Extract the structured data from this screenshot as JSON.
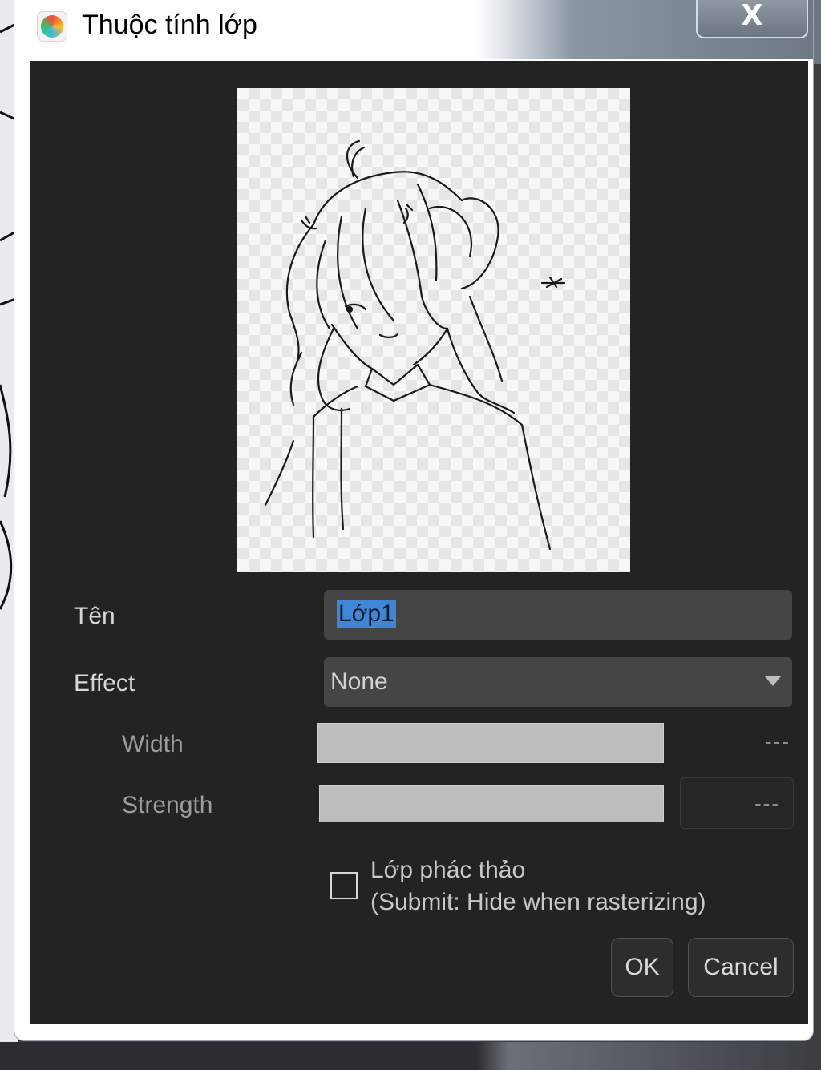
{
  "window": {
    "title": "Thuộc tính lớp",
    "close_label": "X"
  },
  "form": {
    "name_label": "Tên",
    "name_value": "Lớp1",
    "effect_label": "Effect",
    "effect_value": "None",
    "width_label": "Width",
    "width_value": "---",
    "strength_label": "Strength",
    "strength_value": "---",
    "draft_checked": false,
    "draft_label_line1": "Lớp phác thảo",
    "draft_label_line2": "(Submit: Hide when rasterizing)"
  },
  "buttons": {
    "ok": "OK",
    "cancel": "Cancel"
  },
  "icons": {
    "app": "medibang-app-icon",
    "close": "close-icon",
    "dropdown": "chevron-down-icon"
  },
  "colors": {
    "panel": "#232323",
    "input": "#454545",
    "selection": "#3f86d6"
  }
}
